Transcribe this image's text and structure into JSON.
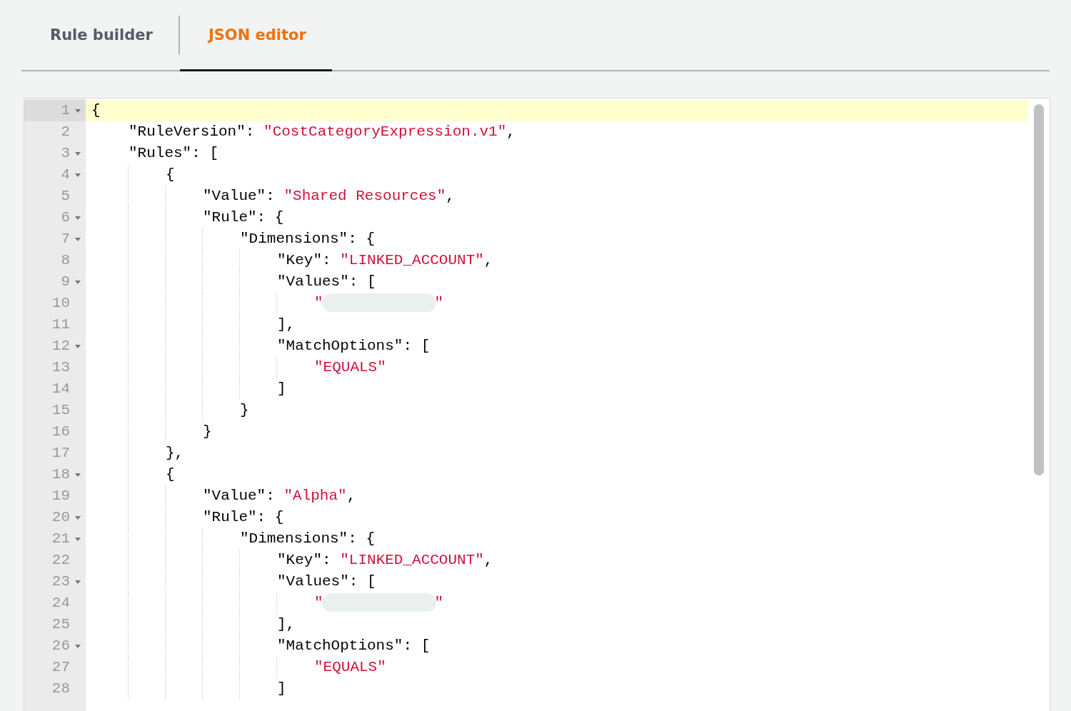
{
  "tabs": [
    {
      "label": "Rule builder",
      "selected": false
    },
    {
      "label": "JSON editor",
      "selected": true
    }
  ],
  "editor": {
    "lines": [
      {
        "number": "1",
        "current": true,
        "expanded": true,
        "tokens": [
          {
            "kind": "text",
            "text": "{"
          }
        ],
        "children": [
          {
            "number": "2",
            "current": false,
            "tokens": [
              {
                "kind": "text",
                "text": "\"RuleVersion\": "
              },
              {
                "kind": "string",
                "text": "\"CostCategoryExpression.v1\""
              },
              {
                "kind": "text",
                "text": ","
              }
            ]
          },
          {
            "number": "3",
            "current": false,
            "expanded": true,
            "tokens": [
              {
                "kind": "text",
                "text": "\"Rules\": ["
              }
            ],
            "children": [
              {
                "number": "4",
                "current": false,
                "expanded": true,
                "tokens": [
                  {
                    "kind": "text",
                    "text": "{"
                  }
                ],
                "children": [
                  {
                    "number": "5",
                    "current": false,
                    "tokens": [
                      {
                        "kind": "text",
                        "text": "\"Value\": "
                      },
                      {
                        "kind": "string",
                        "text": "\"Shared Resources\""
                      },
                      {
                        "kind": "text",
                        "text": ","
                      }
                    ]
                  },
                  {
                    "number": "6",
                    "current": false,
                    "expanded": true,
                    "tokens": [
                      {
                        "kind": "text",
                        "text": "\"Rule\": {"
                      }
                    ],
                    "children": [
                      {
                        "number": "7",
                        "current": false,
                        "expanded": true,
                        "tokens": [
                          {
                            "kind": "text",
                            "text": "\"Dimensions\": {"
                          }
                        ],
                        "children": [
                          {
                            "number": "8",
                            "current": false,
                            "tokens": [
                              {
                                "kind": "text",
                                "text": "\"Key\": "
                              },
                              {
                                "kind": "string",
                                "text": "\"LINKED_ACCOUNT\""
                              },
                              {
                                "kind": "text",
                                "text": ","
                              }
                            ]
                          },
                          {
                            "number": "9",
                            "current": false,
                            "expanded": true,
                            "tokens": [
                              {
                                "kind": "text",
                                "text": "\"Values\": ["
                              }
                            ],
                            "children": [
                              {
                                "number": "10",
                                "current": false,
                                "tokens": [
                                  {
                                    "kind": "string",
                                    "text": "\""
                                  },
                                  {
                                    "kind": "redacted"
                                  },
                                  {
                                    "kind": "string",
                                    "text": "\""
                                  }
                                ]
                              }
                            ]
                          },
                          {
                            "number": "11",
                            "current": false,
                            "tokens": [
                              {
                                "kind": "text",
                                "text": "],"
                              }
                            ]
                          },
                          {
                            "number": "12",
                            "current": false,
                            "expanded": true,
                            "tokens": [
                              {
                                "kind": "text",
                                "text": "\"MatchOptions\": ["
                              }
                            ],
                            "children": [
                              {
                                "number": "13",
                                "current": false,
                                "tokens": [
                                  {
                                    "kind": "string",
                                    "text": "\"EQUALS\""
                                  }
                                ]
                              }
                            ]
                          },
                          {
                            "number": "14",
                            "current": false,
                            "tokens": [
                              {
                                "kind": "text",
                                "text": "]"
                              }
                            ]
                          }
                        ]
                      },
                      {
                        "number": "15",
                        "current": false,
                        "tokens": [
                          {
                            "kind": "text",
                            "text": "}"
                          }
                        ]
                      }
                    ]
                  },
                  {
                    "number": "16",
                    "current": false,
                    "tokens": [
                      {
                        "kind": "text",
                        "text": "}"
                      }
                    ]
                  }
                ]
              },
              {
                "number": "17",
                "current": false,
                "tokens": [
                  {
                    "kind": "text",
                    "text": "},"
                  }
                ]
              },
              {
                "number": "18",
                "current": false,
                "expanded": true,
                "tokens": [
                  {
                    "kind": "text",
                    "text": "{"
                  }
                ],
                "children": [
                  {
                    "number": "19",
                    "current": false,
                    "tokens": [
                      {
                        "kind": "text",
                        "text": "\"Value\": "
                      },
                      {
                        "kind": "string",
                        "text": "\"Alpha\""
                      },
                      {
                        "kind": "text",
                        "text": ","
                      }
                    ]
                  },
                  {
                    "number": "20",
                    "current": false,
                    "expanded": true,
                    "tokens": [
                      {
                        "kind": "text",
                        "text": "\"Rule\": {"
                      }
                    ],
                    "children": [
                      {
                        "number": "21",
                        "current": false,
                        "expanded": true,
                        "tokens": [
                          {
                            "kind": "text",
                            "text": "\"Dimensions\": {"
                          }
                        ],
                        "children": [
                          {
                            "number": "22",
                            "current": false,
                            "tokens": [
                              {
                                "kind": "text",
                                "text": "\"Key\": "
                              },
                              {
                                "kind": "string",
                                "text": "\"LINKED_ACCOUNT\""
                              },
                              {
                                "kind": "text",
                                "text": ","
                              }
                            ]
                          },
                          {
                            "number": "23",
                            "current": false,
                            "expanded": true,
                            "tokens": [
                              {
                                "kind": "text",
                                "text": "\"Values\": ["
                              }
                            ],
                            "children": [
                              {
                                "number": "24",
                                "current": false,
                                "tokens": [
                                  {
                                    "kind": "string",
                                    "text": "\""
                                  },
                                  {
                                    "kind": "redacted"
                                  },
                                  {
                                    "kind": "string",
                                    "text": "\""
                                  }
                                ]
                              }
                            ]
                          },
                          {
                            "number": "25",
                            "current": false,
                            "tokens": [
                              {
                                "kind": "text",
                                "text": "],"
                              }
                            ]
                          },
                          {
                            "number": "26",
                            "current": false,
                            "expanded": true,
                            "tokens": [
                              {
                                "kind": "text",
                                "text": "\"MatchOptions\": ["
                              }
                            ],
                            "children": [
                              {
                                "number": "27",
                                "current": false,
                                "tokens": [
                                  {
                                    "kind": "string",
                                    "text": "\"EQUALS\""
                                  }
                                ]
                              }
                            ]
                          },
                          {
                            "number": "28",
                            "current": false,
                            "tokens": [
                              {
                                "kind": "text",
                                "text": "]"
                              }
                            ]
                          }
                        ]
                      }
                    ]
                  }
                ]
              }
            ]
          }
        ]
      }
    ]
  }
}
